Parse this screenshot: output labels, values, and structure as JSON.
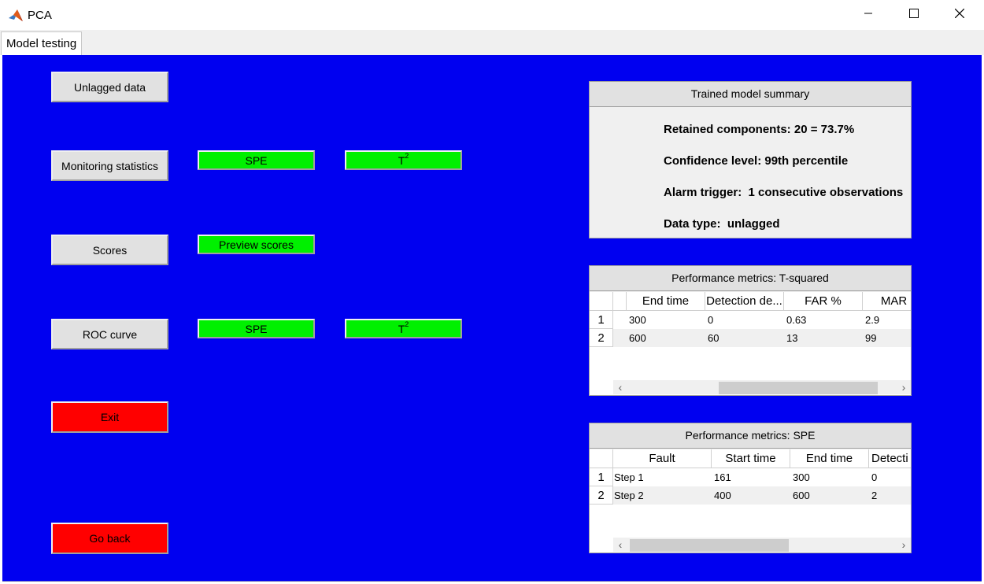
{
  "window": {
    "title": "PCA"
  },
  "tabs": [
    {
      "label": "Model testing"
    }
  ],
  "buttons": {
    "unlagged_data": "Unlagged data",
    "monitoring_statistics": "Monitoring statistics",
    "spe_monitor": "SPE",
    "t2_monitor_base": "T",
    "t2_monitor_sup": "2",
    "scores": "Scores",
    "preview_scores": "Preview scores",
    "roc_curve": "ROC curve",
    "spe_roc": "SPE",
    "t2_roc_base": "T",
    "t2_roc_sup": "2",
    "exit": "Exit",
    "go_back": "Go back"
  },
  "summary": {
    "title": "Trained model summary",
    "retained": "Retained components: 20 = 73.7%",
    "confidence": "Confidence level: 99th percentile",
    "alarm": "Alarm trigger:  1 consecutive observations",
    "datatype": "Data type:  unlagged"
  },
  "t2_table": {
    "title": "Performance metrics: T-squared",
    "headers": [
      "",
      "End time",
      "Detection de...",
      "FAR %",
      "MAR"
    ],
    "row_labels": [
      "1",
      "2"
    ],
    "rows": [
      [
        "",
        "300",
        "0",
        "0.63",
        "2.9"
      ],
      [
        "",
        "600",
        "60",
        "13",
        "99"
      ]
    ]
  },
  "spe_table": {
    "title": "Performance metrics: SPE",
    "headers": [
      "Fault",
      "Start time",
      "End time",
      "Detecti"
    ],
    "row_labels": [
      "1",
      "2"
    ],
    "rows": [
      [
        "Step 1",
        "161",
        "300",
        "0"
      ],
      [
        "Step 2",
        "400",
        "600",
        "2"
      ]
    ]
  },
  "colors": {
    "background": "#0000f0",
    "green_button": "#00f000",
    "red_button": "#ff0000",
    "gray_button": "#e1e1e1"
  },
  "icons": [
    "matlab-logo-icon",
    "minimize-icon",
    "maximize-icon",
    "close-icon",
    "scroll-left-icon",
    "scroll-right-icon"
  ]
}
